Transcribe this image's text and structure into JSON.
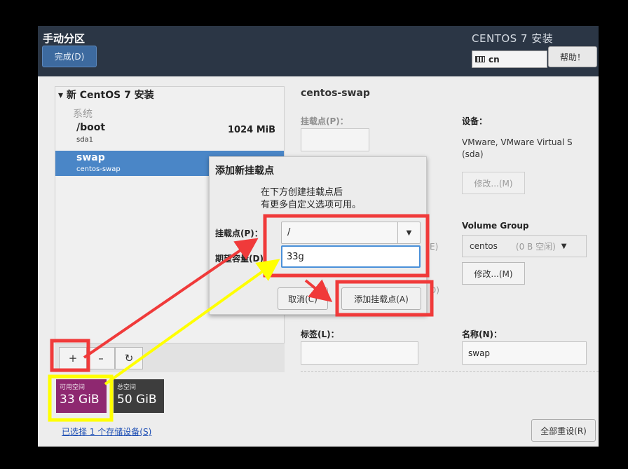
{
  "header": {
    "title": "手动分区",
    "done_label": "完成(D)",
    "product": "CENTOS 7 安装",
    "keyboard": "cn",
    "help_label": "帮助！"
  },
  "left": {
    "install_title": "新 CentOS 7 安装",
    "system_label": "系统",
    "rows": [
      {
        "name": "/boot",
        "device": "sda1",
        "size": "1024 MiB"
      },
      {
        "name": "swap",
        "device": "centos-swap",
        "size": ""
      }
    ],
    "toolbar": {
      "add": "+",
      "remove": "–",
      "refresh": "↻"
    },
    "available_label": "可用空间",
    "available_value": "33 GiB",
    "total_label": "总空间",
    "total_value": "50 GiB",
    "selected_link": "已选择 1 个存储设备(S)",
    "reset_label": "全部重设(R)"
  },
  "right": {
    "title": "centos-swap",
    "mount_label": "挂载点(P)：",
    "device_label": "设备：",
    "device_value": "VMware, VMware Virtual S (sda)",
    "modify_label": "修改...(M)",
    "vg_label": "Volume Group",
    "vg_name": "centos",
    "vg_free": "(0 B 空闲)",
    "modify2_label": "修改...(M)",
    "tag_label": "标签(L)：",
    "name_label": "名称(N)：",
    "name_value": "swap",
    "peek1": "E)",
    "peek2": "D)"
  },
  "dialog": {
    "title": "添加新挂载点",
    "desc_line1": "在下方创建挂载点后",
    "desc_line2": "有更多自定义选项可用。",
    "mount_label": "挂载点(P)：",
    "mount_value": "/",
    "capacity_label": "期望容量(D)：",
    "capacity_value": "33g",
    "cancel_label": "取消(C)",
    "add_label": "添加挂载点(A)"
  },
  "colors": {
    "header_bg": "#2b3645",
    "selected_row": "#4a86c7",
    "available_bg": "#8e2870",
    "annotation_red": "#f03a3a",
    "annotation_yellow": "#ffff00"
  }
}
